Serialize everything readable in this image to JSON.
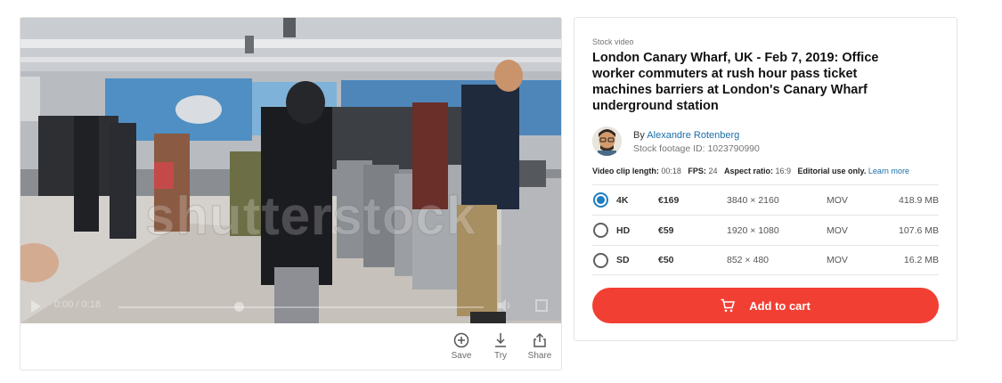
{
  "video": {
    "watermark": "shutterstock",
    "time": "0:00 / 0:18"
  },
  "actions": [
    {
      "icon": "plus-circle-icon",
      "label": "Save"
    },
    {
      "icon": "download-icon",
      "label": "Try"
    },
    {
      "icon": "share-icon",
      "label": "Share"
    }
  ],
  "info": {
    "kicker": "Stock video",
    "title": "London Canary Wharf, UK - Feb 7, 2019: Office worker commuters at rush hour pass ticket machines barriers at London's Canary Wharf underground station",
    "by": "By",
    "author": "Alexandre Rotenberg",
    "footage_id": "Stock footage ID: 1023790990",
    "specs": {
      "length_label": "Video clip length:",
      "length": "00:18",
      "fps_label": "FPS:",
      "fps": "24",
      "aspect_label": "Aspect ratio:",
      "aspect": "16:9",
      "editorial": "Editorial use only.",
      "learn_more": "Learn more"
    },
    "options": [
      {
        "size": "4K",
        "price": "€169",
        "resolution": "3840 × 2160",
        "format": "MOV",
        "filesize": "418.9 MB",
        "selected": true
      },
      {
        "size": "HD",
        "price": "€59",
        "resolution": "1920 × 1080",
        "format": "MOV",
        "filesize": "107.6 MB",
        "selected": false
      },
      {
        "size": "SD",
        "price": "€50",
        "resolution": "852 × 480",
        "format": "MOV",
        "filesize": "16.2 MB",
        "selected": false
      }
    ],
    "cart_label": "Add to cart"
  },
  "colors": {
    "accent": "#f23f33",
    "link": "#1a6fa8",
    "radio_selected": "#1e7ec0"
  }
}
